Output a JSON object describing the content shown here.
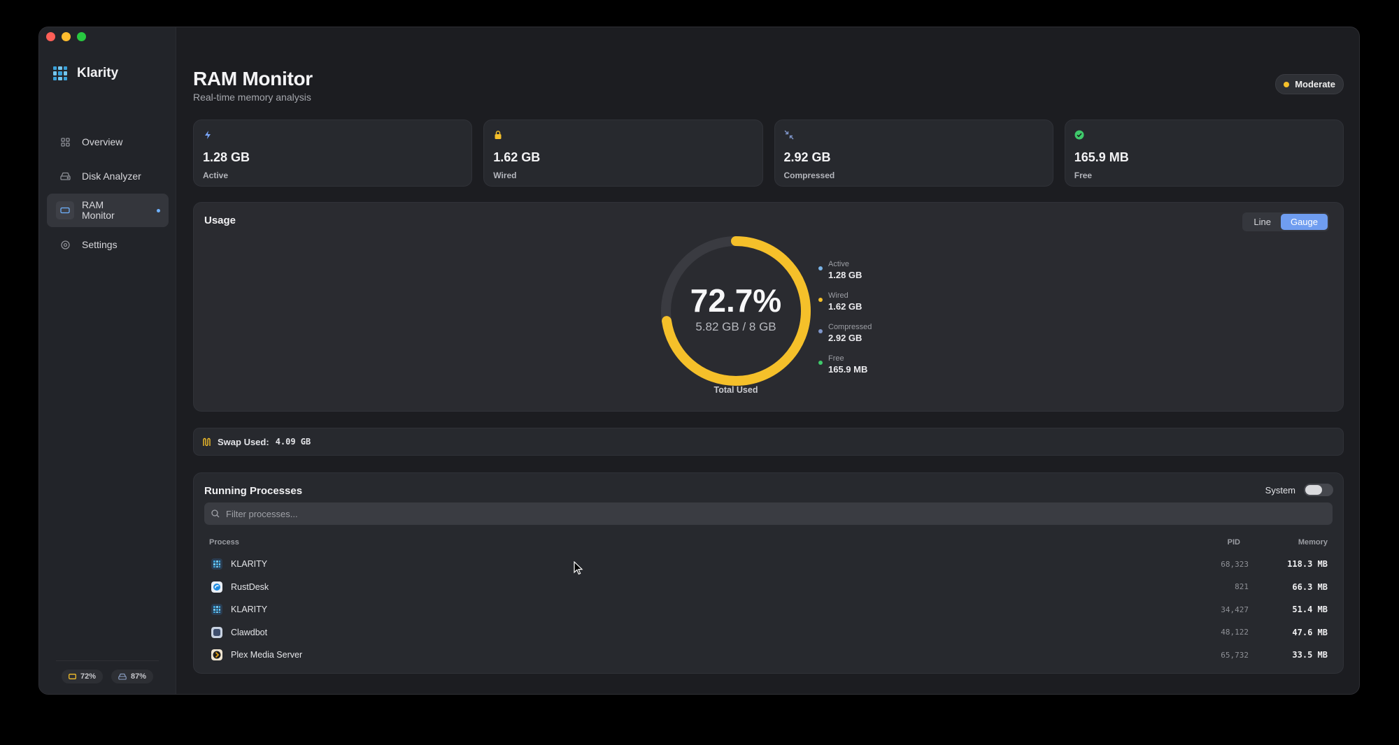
{
  "app": {
    "name": "Klarity"
  },
  "sidebar": {
    "items": [
      {
        "label": "Overview",
        "icon": "grid-icon"
      },
      {
        "label": "Disk Analyzer",
        "icon": "disk-icon"
      },
      {
        "label": "RAM Monitor",
        "icon": "ram-icon"
      },
      {
        "label": "Settings",
        "icon": "gear-icon"
      }
    ],
    "footer": {
      "ram_percent": "72%",
      "disk_percent": "87%"
    }
  },
  "header": {
    "title": "RAM Monitor",
    "subtitle": "Real-time memory analysis",
    "status": "Moderate",
    "status_color": "#f5c02a"
  },
  "stats": [
    {
      "value": "1.28 GB",
      "label": "Active",
      "icon": "bolt-icon",
      "color": "#7aa7ff"
    },
    {
      "value": "1.62 GB",
      "label": "Wired",
      "icon": "lock-icon",
      "color": "#f5c02a"
    },
    {
      "value": "2.92 GB",
      "label": "Compressed",
      "icon": "compress-icon",
      "color": "#7f95c9"
    },
    {
      "value": "165.9 MB",
      "label": "Free",
      "icon": "check-circle-icon",
      "color": "#3fca6b"
    }
  ],
  "usage": {
    "title": "Usage",
    "view_options": [
      "Line",
      "Gauge"
    ],
    "selected_view": "Gauge",
    "percent_text": "72.7%",
    "percent_value": 72.7,
    "used_text": "5.82 GB / 8 GB",
    "caption": "Total Used",
    "gauge_color": "#f5c02a",
    "legend": [
      {
        "name": "Active",
        "value": "1.28 GB",
        "color": "#7ab3e6"
      },
      {
        "name": "Wired",
        "value": "1.62 GB",
        "color": "#f5c02a"
      },
      {
        "name": "Compressed",
        "value": "2.92 GB",
        "color": "#7f95c9"
      },
      {
        "name": "Free",
        "value": "165.9 MB",
        "color": "#3fca6b"
      }
    ]
  },
  "swap": {
    "label": "Swap Used:",
    "value": "4.09 GB"
  },
  "processes": {
    "title": "Running Processes",
    "system_toggle_label": "System",
    "filter_placeholder": "Filter processes...",
    "columns": {
      "process": "Process",
      "pid": "PID",
      "memory": "Memory"
    },
    "rows": [
      {
        "name": "KLARITY",
        "pid": "68,323",
        "memory": "118.3 MB",
        "icon": "klarity-icon"
      },
      {
        "name": "RustDesk",
        "pid": "821",
        "memory": "66.3 MB",
        "icon": "rustdesk-icon"
      },
      {
        "name": "KLARITY",
        "pid": "34,427",
        "memory": "51.4 MB",
        "icon": "klarity-icon"
      },
      {
        "name": "Clawdbot",
        "pid": "48,122",
        "memory": "47.6 MB",
        "icon": "clawdbot-icon"
      },
      {
        "name": "Plex Media Server",
        "pid": "65,732",
        "memory": "33.5 MB",
        "icon": "plex-icon"
      }
    ]
  }
}
